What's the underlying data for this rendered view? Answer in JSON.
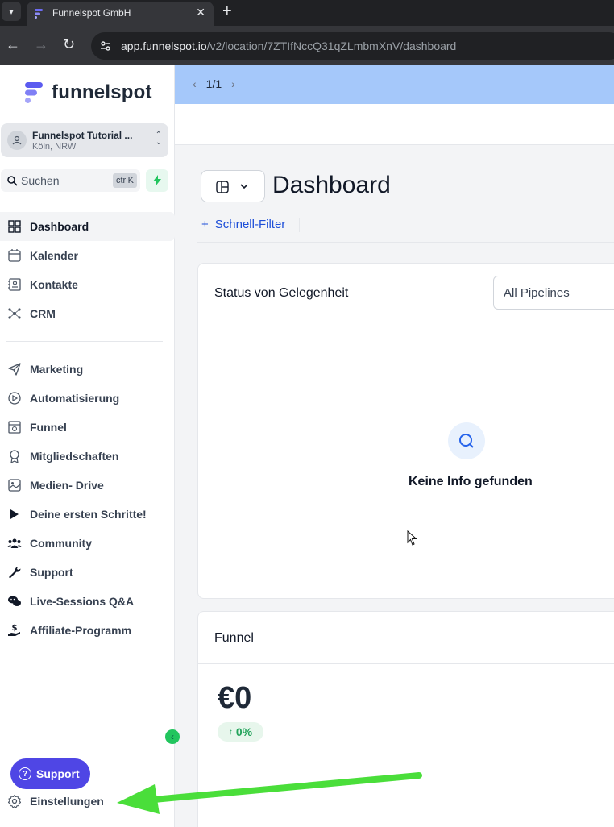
{
  "browser": {
    "tab_title": "Funnelspot GmbH",
    "new_tab": "+",
    "close": "✕",
    "url_host": "app.funnelspot.io",
    "url_path": "/v2/location/7ZTIfNccQ31qZLmbmXnV/dashboard"
  },
  "sidebar": {
    "logo_text": "funnelspot",
    "account_name": "Funnelspot Tutorial ...",
    "account_location": "Köln, NRW",
    "search_placeholder": "Suchen",
    "search_shortcut": "ctrlK",
    "items": [
      {
        "label": "Dashboard",
        "icon": "dashboard-icon",
        "active": true
      },
      {
        "label": "Kalender",
        "icon": "calendar-icon"
      },
      {
        "label": "Kontakte",
        "icon": "contacts-icon"
      },
      {
        "label": "CRM",
        "icon": "crm-icon"
      },
      {
        "label": "Marketing",
        "icon": "send-icon"
      },
      {
        "label": "Automatisierung",
        "icon": "automation-icon"
      },
      {
        "label": "Funnel",
        "icon": "funnel-icon"
      },
      {
        "label": "Mitgliedschaften",
        "icon": "membership-icon"
      },
      {
        "label": "Medien- Drive",
        "icon": "image-icon"
      },
      {
        "label": "Deine ersten Schritte!",
        "icon": "play-icon"
      },
      {
        "label": "Community",
        "icon": "community-icon"
      },
      {
        "label": "Support",
        "icon": "wrench-icon"
      },
      {
        "label": "Live-Sessions Q&A",
        "icon": "chat-icon"
      },
      {
        "label": "Affiliate-Programm",
        "icon": "hand-money-icon"
      }
    ],
    "support_button": "Support",
    "settings_label": "Einstellungen"
  },
  "main": {
    "pager": "1/1",
    "page_title": "Dashboard",
    "quick_filter": "Schnell-Filter",
    "card_opportunity": {
      "title": "Status von Gelegenheit",
      "select_value": "All Pipelines",
      "empty_text": "Keine Info gefunden"
    },
    "card_funnel": {
      "title": "Funnel",
      "amount": "€0",
      "change": "0%"
    }
  },
  "colors": {
    "brand": "#4f46e5",
    "banner": "#a5c8fa",
    "annotation_arrow": "#4ade3a",
    "positive": "#22a35a"
  }
}
